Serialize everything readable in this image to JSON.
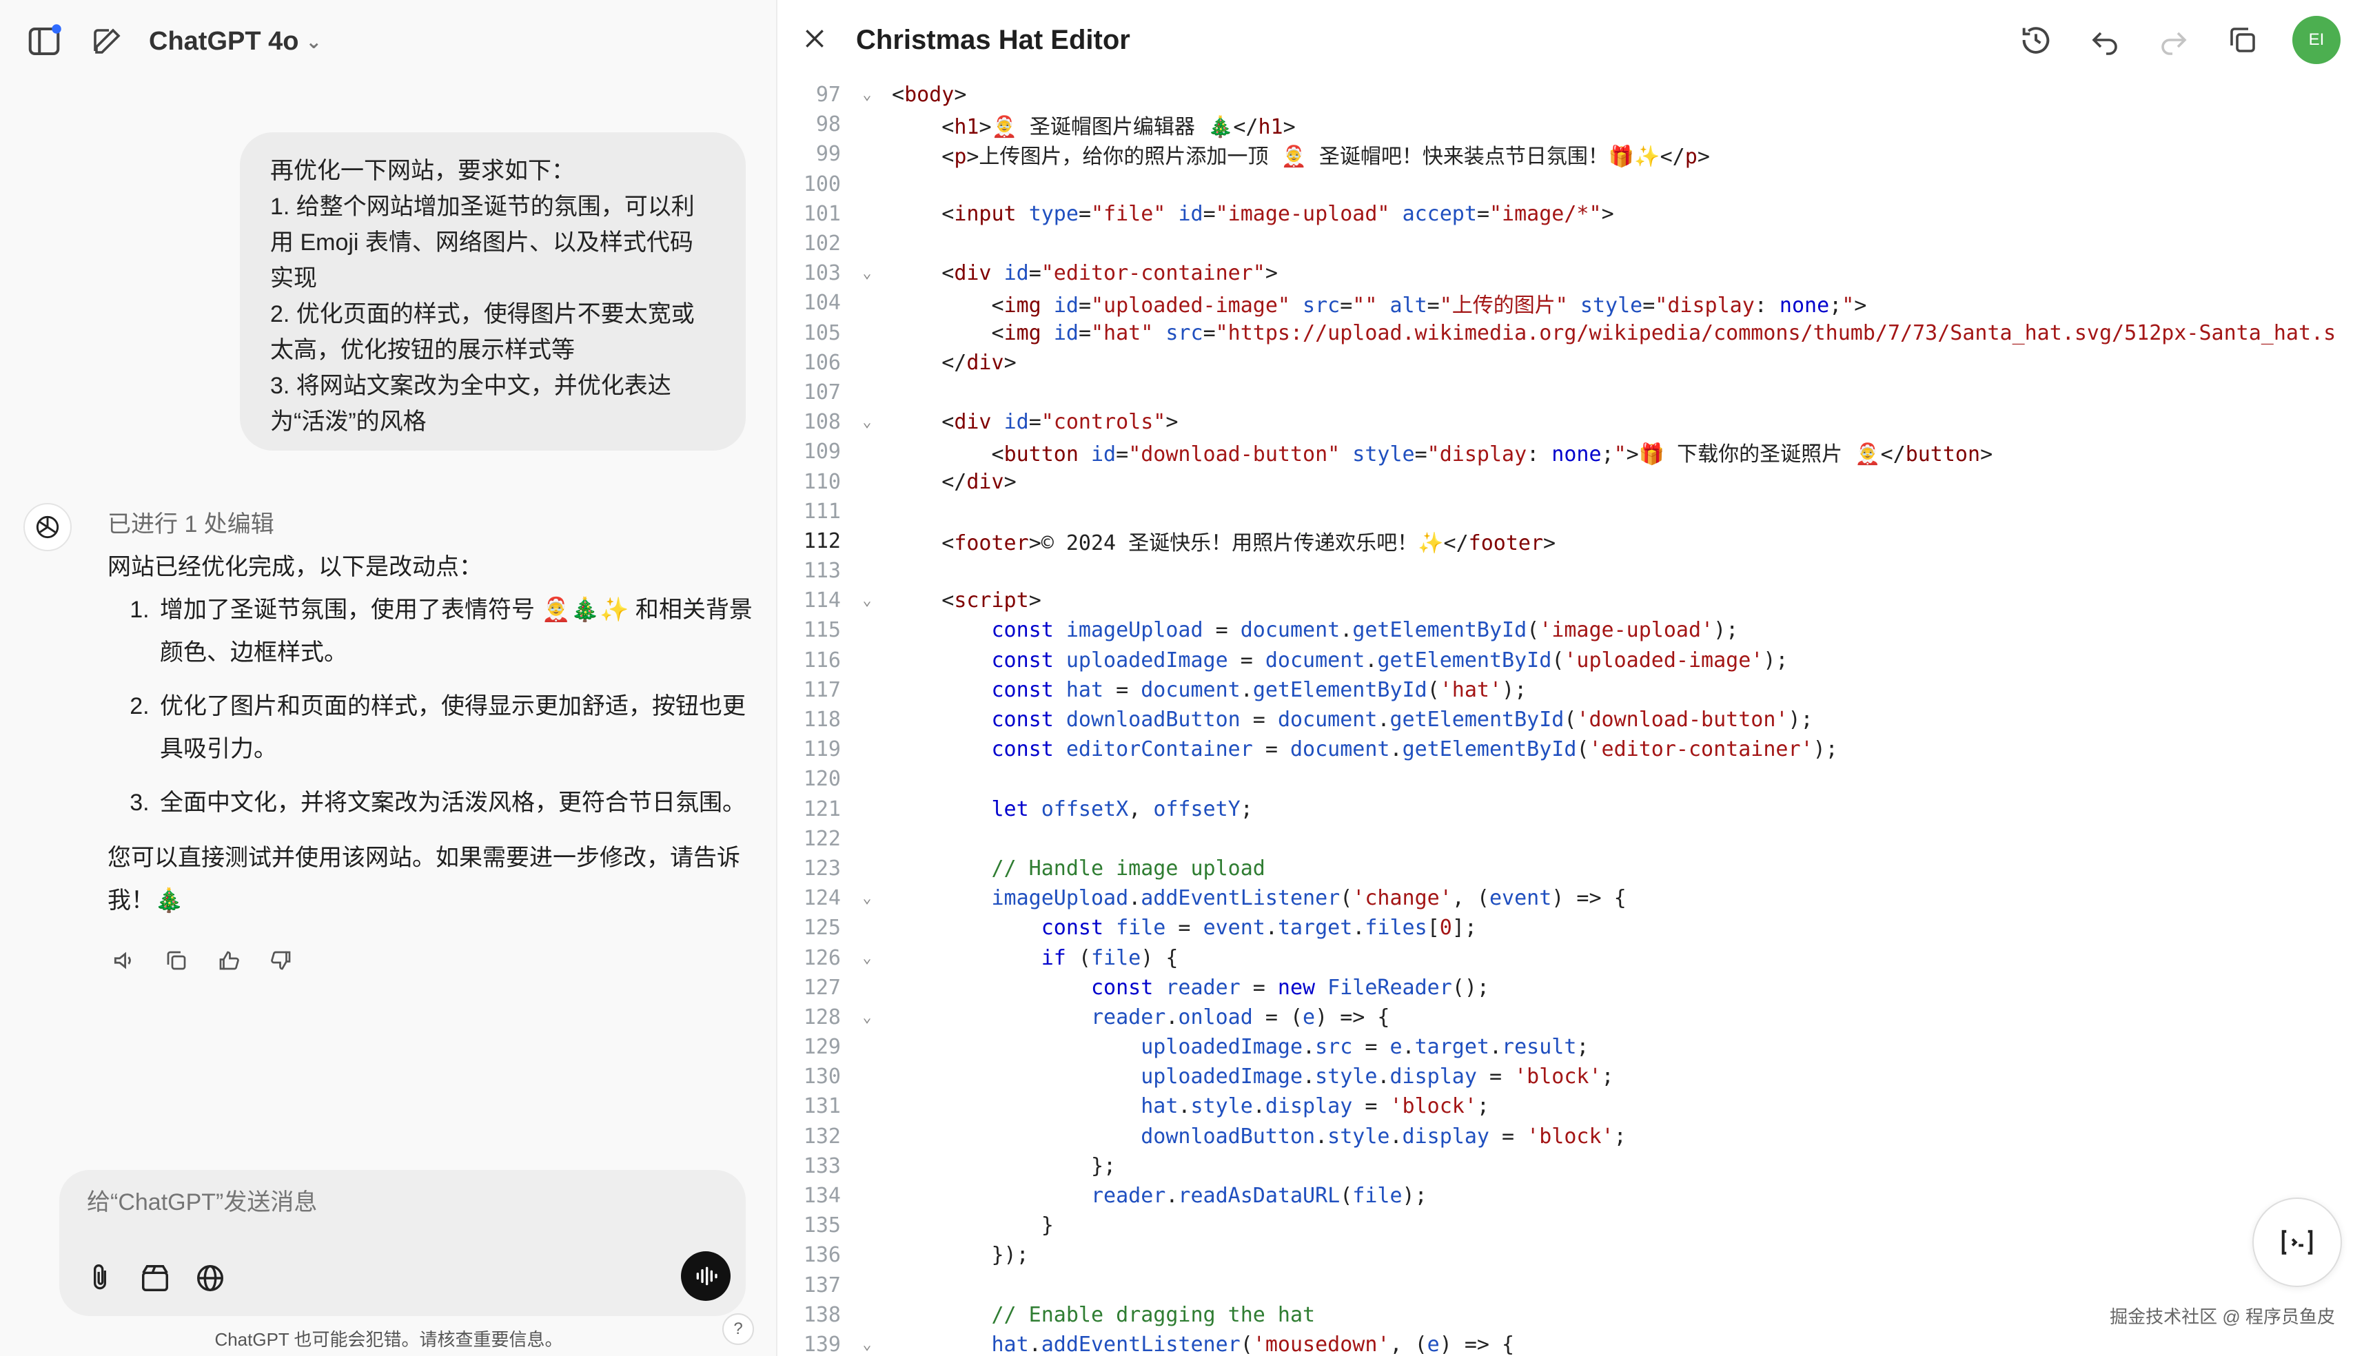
{
  "app": {
    "model_label": "ChatGPT 4o",
    "panel_title": "Christmas Hat Editor",
    "user_avatar_initials": "EI"
  },
  "user_message": {
    "lines": [
      "再优化一下网站，要求如下：",
      "1. 给整个网站增加圣诞节的氛围，可以利用 Emoji 表情、网络图片、以及样式代码实现",
      "2. 优化页面的样式，使得图片不要太宽或太高，优化按钮的展示样式等",
      "3. 将网站文案改为全中文，并优化表达为“活泼”的风格"
    ]
  },
  "assistant_message": {
    "edit_note": "已进行 1 处编辑",
    "intro": "网站已经优化完成，以下是改动点：",
    "items": [
      "增加了圣诞节氛围，使用了表情符号 🤶🎄✨ 和相关背景颜色、边框样式。",
      "优化了图片和页面的样式，使得显示更加舒适，按钮也更具吸引力。",
      "全面中文化，并将文案改为活泼风格，更符合节日氛围。"
    ],
    "closing": "您可以直接测试并使用该网站。如果需要进一步修改，请告诉我！🎄"
  },
  "composer": {
    "placeholder": "给“ChatGPT”发送消息",
    "disclaimer": "ChatGPT 也可能会犯错。请核查重要信息。"
  },
  "code_lines": [
    {
      "n": "97",
      "fold": true,
      "html": "&lt;<span class='t'>body</span>&gt;"
    },
    {
      "n": "98",
      "fold": false,
      "html": "    &lt;<span class='t'>h1</span>&gt;🤶 圣诞帽图片编辑器 🎄&lt;/<span class='t'>h1</span>&gt;"
    },
    {
      "n": "99",
      "fold": false,
      "html": "    &lt;<span class='t'>p</span>&gt;上传图片，给你的照片添加一顶 🤶 圣诞帽吧！快来装点节日氛围！🎁✨&lt;/<span class='t'>p</span>&gt;"
    },
    {
      "n": "100",
      "fold": false,
      "html": ""
    },
    {
      "n": "101",
      "fold": false,
      "html": "    &lt;<span class='t'>input</span> <span class='v'>type</span>=<span class='s'>\"file\"</span> <span class='v'>id</span>=<span class='s'>\"image-upload\"</span> <span class='v'>accept</span>=<span class='s'>\"image/*\"</span>&gt;"
    },
    {
      "n": "102",
      "fold": false,
      "html": ""
    },
    {
      "n": "103",
      "fold": true,
      "html": "    &lt;<span class='t'>div</span> <span class='v'>id</span>=<span class='s'>\"editor-container\"</span>&gt;"
    },
    {
      "n": "104",
      "fold": false,
      "html": "        &lt;<span class='t'>img</span> <span class='v'>id</span>=<span class='s'>\"uploaded-image\"</span> <span class='v'>src</span>=<span class='s'>\"\"</span> <span class='v'>alt</span>=<span class='s'>\"上传的图片\"</span> <span class='v'>style</span>=<span class='s'>\"display</span>: <span class='k'>none</span>;<span class='s'>\"</span>&gt;"
    },
    {
      "n": "105",
      "fold": false,
      "html": "        &lt;<span class='t'>img</span> <span class='v'>id</span>=<span class='s'>\"hat\"</span> <span class='v'>src</span>=<span class='s'>\"https://upload.wikimedia.org/wikipedia/commons/thumb/7/73/Santa_hat.svg/512px-Santa_hat.s</span>"
    },
    {
      "n": "106",
      "fold": false,
      "html": "    &lt;/<span class='t'>div</span>&gt;"
    },
    {
      "n": "107",
      "fold": false,
      "html": ""
    },
    {
      "n": "108",
      "fold": true,
      "html": "    &lt;<span class='t'>div</span> <span class='v'>id</span>=<span class='s'>\"controls\"</span>&gt;"
    },
    {
      "n": "109",
      "fold": false,
      "html": "        &lt;<span class='t'>button</span> <span class='v'>id</span>=<span class='s'>\"download-button\"</span> <span class='v'>style</span>=<span class='s'>\"display</span>: <span class='k'>none</span>;<span class='s'>\"</span>&gt;🎁 下载你的圣诞照片 🤶&lt;/<span class='t'>button</span>&gt;"
    },
    {
      "n": "110",
      "fold": false,
      "html": "    &lt;/<span class='t'>div</span>&gt;"
    },
    {
      "n": "111",
      "fold": false,
      "html": ""
    },
    {
      "n": "112",
      "fold": false,
      "active": true,
      "html": "    &lt;<span class='t'>footer</span>&gt;© 2024 圣诞快乐！用照片传递欢乐吧！✨&lt;/<span class='t'>footer</span>&gt;"
    },
    {
      "n": "113",
      "fold": false,
      "html": ""
    },
    {
      "n": "114",
      "fold": true,
      "html": "    &lt;<span class='t'>script</span>&gt;"
    },
    {
      "n": "115",
      "fold": false,
      "html": "        <span class='k'>const</span> <span class='v'>imageUpload</span> = <span class='v'>document</span>.<span class='v'>getElementById</span>(<span class='s'>'image-upload'</span>);"
    },
    {
      "n": "116",
      "fold": false,
      "html": "        <span class='k'>const</span> <span class='v'>uploadedImage</span> = <span class='v'>document</span>.<span class='v'>getElementById</span>(<span class='s'>'uploaded-image'</span>);"
    },
    {
      "n": "117",
      "fold": false,
      "html": "        <span class='k'>const</span> <span class='v'>hat</span> = <span class='v'>document</span>.<span class='v'>getElementById</span>(<span class='s'>'hat'</span>);"
    },
    {
      "n": "118",
      "fold": false,
      "html": "        <span class='k'>const</span> <span class='v'>downloadButton</span> = <span class='v'>document</span>.<span class='v'>getElementById</span>(<span class='s'>'download-button'</span>);"
    },
    {
      "n": "119",
      "fold": false,
      "html": "        <span class='k'>const</span> <span class='v'>editorContainer</span> = <span class='v'>document</span>.<span class='v'>getElementById</span>(<span class='s'>'editor-container'</span>);"
    },
    {
      "n": "120",
      "fold": false,
      "html": ""
    },
    {
      "n": "121",
      "fold": false,
      "html": "        <span class='k'>let</span> <span class='v'>offsetX</span>, <span class='v'>offsetY</span>;"
    },
    {
      "n": "122",
      "fold": false,
      "html": ""
    },
    {
      "n": "123",
      "fold": false,
      "html": "        <span class='c'>// Handle image upload</span>"
    },
    {
      "n": "124",
      "fold": true,
      "html": "        <span class='v'>imageUpload</span>.<span class='v'>addEventListener</span>(<span class='s'>'change'</span>, (<span class='v'>event</span>) =&gt; {"
    },
    {
      "n": "125",
      "fold": false,
      "html": "            <span class='k'>const</span> <span class='v'>file</span> = <span class='v'>event</span>.<span class='v'>target</span>.<span class='v'>files</span>[<span class='s'>0</span>];"
    },
    {
      "n": "126",
      "fold": true,
      "html": "            <span class='k'>if</span> (<span class='v'>file</span>) {"
    },
    {
      "n": "127",
      "fold": false,
      "html": "                <span class='k'>const</span> <span class='v'>reader</span> = <span class='k'>new</span> <span class='v'>FileReader</span>();"
    },
    {
      "n": "128",
      "fold": true,
      "html": "                <span class='v'>reader</span>.<span class='v'>onload</span> = (<span class='v'>e</span>) =&gt; {"
    },
    {
      "n": "129",
      "fold": false,
      "html": "                    <span class='v'>uploadedImage</span>.<span class='v'>src</span> = <span class='v'>e</span>.<span class='v'>target</span>.<span class='v'>result</span>;"
    },
    {
      "n": "130",
      "fold": false,
      "html": "                    <span class='v'>uploadedImage</span>.<span class='v'>style</span>.<span class='v'>display</span> = <span class='s'>'block'</span>;"
    },
    {
      "n": "131",
      "fold": false,
      "html": "                    <span class='v'>hat</span>.<span class='v'>style</span>.<span class='v'>display</span> = <span class='s'>'block'</span>;"
    },
    {
      "n": "132",
      "fold": false,
      "html": "                    <span class='v'>downloadButton</span>.<span class='v'>style</span>.<span class='v'>display</span> = <span class='s'>'block'</span>;"
    },
    {
      "n": "133",
      "fold": false,
      "html": "                };"
    },
    {
      "n": "134",
      "fold": false,
      "html": "                <span class='v'>reader</span>.<span class='v'>readAsDataURL</span>(<span class='v'>file</span>);"
    },
    {
      "n": "135",
      "fold": false,
      "html": "            }"
    },
    {
      "n": "136",
      "fold": false,
      "html": "        });"
    },
    {
      "n": "137",
      "fold": false,
      "html": ""
    },
    {
      "n": "138",
      "fold": false,
      "html": "        <span class='c'>// Enable dragging the hat</span>"
    },
    {
      "n": "139",
      "fold": true,
      "html": "        <span class='v'>hat</span>.<span class='v'>addEventListener</span>(<span class='s'>'mousedown'</span>, (<span class='v'>e</span>) =&gt; {"
    }
  ],
  "watermark": "掘金技术社区 @ 程序员鱼皮",
  "colors": {
    "accent_blue": "#1f4fbf",
    "tag_red": "#800000",
    "string_red": "#a31515",
    "comment_green": "#2f7d32",
    "avatar_green": "#4caf50"
  },
  "icons": [
    "sidebar-toggle-icon",
    "new-chat-icon",
    "close-icon",
    "history-icon",
    "undo-icon",
    "redo-icon",
    "copy-icon",
    "read-aloud-icon",
    "thumbs-up-icon",
    "thumbs-down-icon",
    "attach-icon",
    "tools-icon",
    "globe-icon",
    "voice-icon",
    "code-expand-icon"
  ]
}
